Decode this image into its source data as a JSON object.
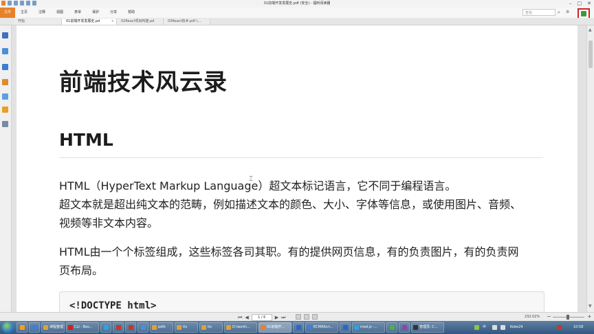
{
  "window": {
    "title": "01前端开发发展史.pdf (安全) - 福昕阅读器"
  },
  "menu": [
    {
      "label": "文件",
      "key": "file"
    },
    {
      "label": "主页",
      "key": "home"
    },
    {
      "label": "注释",
      "key": "comment"
    },
    {
      "label": "视图",
      "key": "view"
    },
    {
      "label": "表单",
      "key": "form"
    },
    {
      "label": "保护",
      "key": "protect"
    },
    {
      "label": "分享",
      "key": "share"
    },
    {
      "label": "帮助",
      "key": "help"
    }
  ],
  "search": {
    "placeholder": "查找"
  },
  "tabs": [
    {
      "label": "开始"
    },
    {
      "label": "01前端开发发展史.pd"
    },
    {
      "label": "02React项目构建.pd"
    },
    {
      "label": "03React技术.pdf (..."
    }
  ],
  "document": {
    "title": "前端技术风云录",
    "heading": "HTML",
    "paragraph1": [
      "HTML（HyperText Markup Language）超文本标记语言，它不同于编程语言。",
      "超文本就是超出纯文本的范畴，例如描述文本的颜色、大小、字体等信息，或使用图片、音频、",
      "视频等非文本内容。"
    ],
    "paragraph2": [
      "HTML由一个个标签组成，这些标签各司其职。有的提供网页信息，有的负责图片，有的负责网",
      "页布局。"
    ],
    "code": "<!DOCTYPE html>"
  },
  "status": {
    "page_indicator": "1 / 6",
    "zoom_text": "232.02%"
  },
  "taskbar": {
    "items": [
      {
        "label": "",
        "color": "#f0a020"
      },
      {
        "label": "",
        "color": "#3c7fd8"
      },
      {
        "label": "课程整理",
        "color": "#d8a23c"
      },
      {
        "label": "CLI - Bas...",
        "color": "#d02020"
      },
      {
        "label": "",
        "color": "#2fa2e0"
      },
      {
        "label": "",
        "color": "#c0392b"
      },
      {
        "label": "",
        "color": "#c0392b"
      },
      {
        "label": "",
        "color": "#4a8fd8"
      },
      {
        "label": "pdfs",
        "color": "#d8a23c"
      },
      {
        "label": "tls",
        "color": "#d8a23c"
      },
      {
        "label": "tls",
        "color": "#d8a23c"
      },
      {
        "label": "D:\\work\\...",
        "color": "#d8a23c"
      },
      {
        "label": "01前端开...",
        "color": "#e9812a"
      },
      {
        "label": "",
        "color": "#2a66c8"
      },
      {
        "label": "ECMAScri...",
        "color": "#3c7fd8"
      },
      {
        "label": "",
        "color": "#2a66c8"
      },
      {
        "label": "mod.js -...",
        "color": "#2fa2e0"
      },
      {
        "label": "",
        "color": "#4caf50"
      },
      {
        "label": "",
        "color": "#8e44ad"
      },
      {
        "label": "管理员: C...",
        "color": "#333333"
      }
    ],
    "tray_lang": "中",
    "tray_user": "Kobe24",
    "tray_time": "10:58"
  }
}
